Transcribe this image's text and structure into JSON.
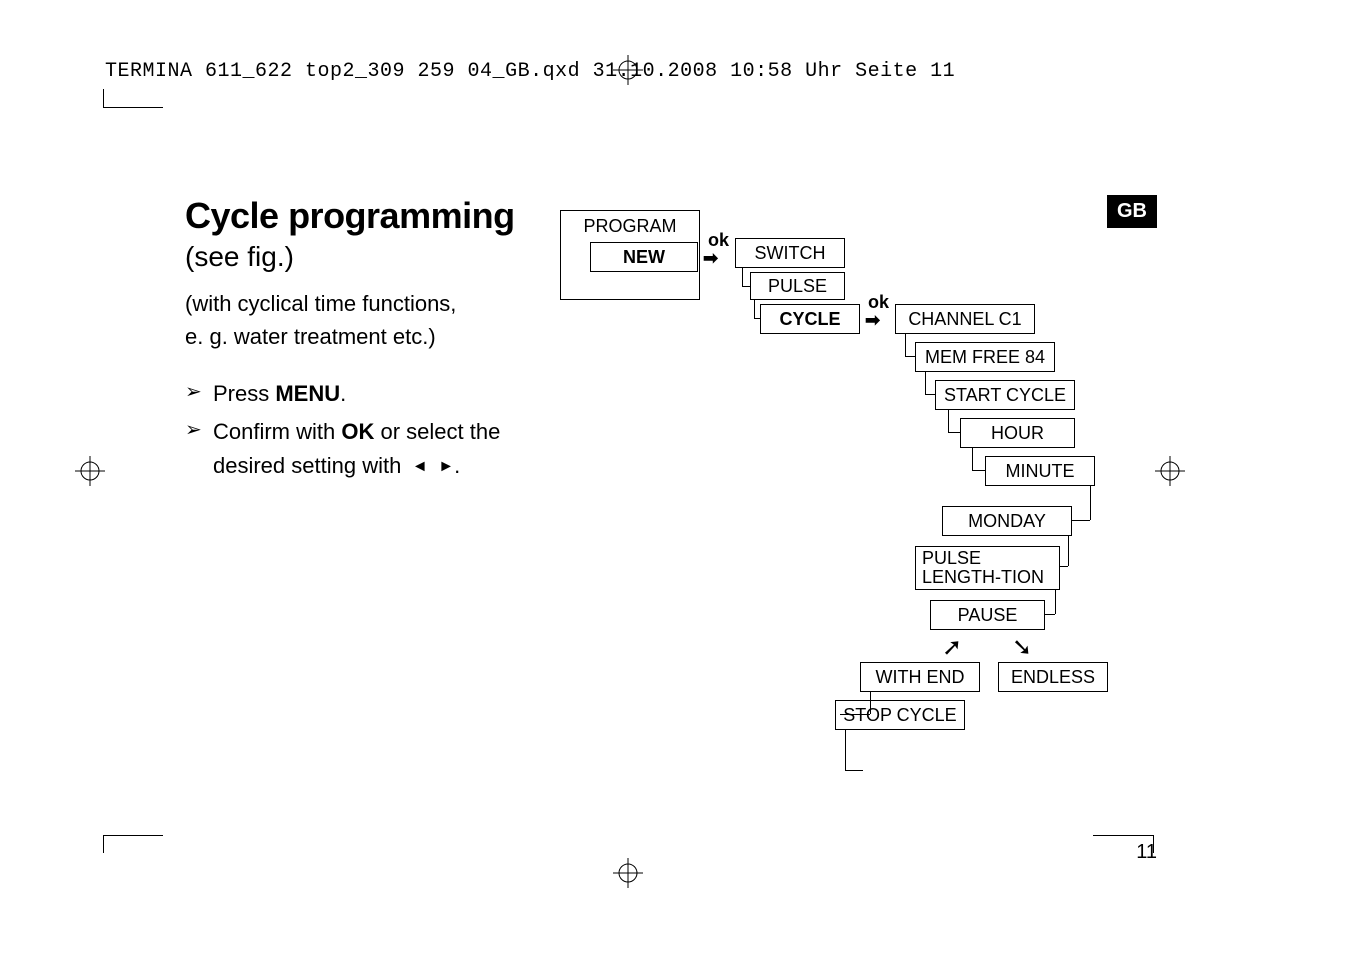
{
  "header": {
    "line": "TERMINA 611_622 top2_309 259 04_GB.qxd  31.10.2008  10:58 Uhr  Seite 11"
  },
  "badge": "GB",
  "main": {
    "title": "Cycle programming",
    "subtitle": "(see fig.)",
    "desc_line1": "(with cyclical time functions,",
    "desc_line2": "e. g. water treatment etc.)",
    "bullets": [
      {
        "pre": "Press ",
        "bold": "MENU",
        "post": "."
      },
      {
        "pre": "Confirm with ",
        "bold": "OK",
        "post": " or select the desired setting with",
        "arrows": true
      }
    ]
  },
  "diagram": {
    "program": "PROGRAM",
    "new": "NEW",
    "ok1": "ok",
    "switch": "SWITCH",
    "pulse": "PULSE",
    "cycle": "CYCLE",
    "ok2": "ok",
    "channel": "CHANNEL C1",
    "memfree": "MEM FREE 84",
    "startcycle": "START CYCLE",
    "hour": "HOUR",
    "minute": "MINUTE",
    "monday": "MONDAY",
    "pulselength": "PULSE LENGTH-TION",
    "pause": "PAUSE",
    "withend": "WITH END",
    "endless": "ENDLESS",
    "stopcycle": "STOP CYCLE"
  },
  "pagenum": "11"
}
